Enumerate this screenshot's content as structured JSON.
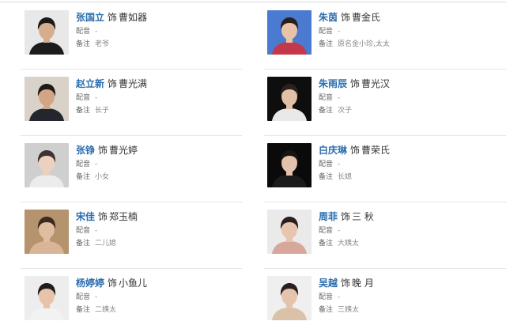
{
  "as_word": "饰",
  "labels": {
    "dub": "配音",
    "note": "备注"
  },
  "cast": [
    {
      "actor": "张国立",
      "role": "曹如器",
      "dub": "-",
      "note": "老爷",
      "photo": {
        "bg": "#e8e8e8",
        "skin": "#d6ad8d",
        "hair": "#1a1a1a",
        "cloth": "#1c1c1c"
      }
    },
    {
      "actor": "朱茵",
      "role": "曹金氏",
      "dub": "-",
      "note": "原名金小珍,太太",
      "photo": {
        "bg": "#4a7bd0",
        "skin": "#e8c3a8",
        "hair": "#2a1e1a",
        "cloth": "#c4384b"
      }
    },
    {
      "actor": "赵立新",
      "role": "曹光满",
      "dub": "-",
      "note": "长子",
      "photo": {
        "bg": "#d9d2c8",
        "skin": "#d2a585",
        "hair": "#1f1b19",
        "cloth": "#23262d"
      }
    },
    {
      "actor": "朱雨辰",
      "role": "曹光汉",
      "dub": "-",
      "note": "次子",
      "photo": {
        "bg": "#0e0e0e",
        "skin": "#e1c0a5",
        "hair": "#2c211d",
        "cloth": "#e9e9e9"
      }
    },
    {
      "actor": "张铮",
      "role": "曹光婷",
      "dub": "-",
      "note": "小女",
      "photo": {
        "bg": "#cfcfcf",
        "skin": "#ecd1bf",
        "hair": "#403230",
        "cloth": "#ececec"
      }
    },
    {
      "actor": "白庆琳",
      "role": "曹荣氏",
      "dub": "-",
      "note": "长媳",
      "photo": {
        "bg": "#0a0a0a",
        "skin": "#e4c1ab",
        "hair": "#1a1414",
        "cloth": "#1b1b1b"
      }
    },
    {
      "actor": "宋佳",
      "role": "郑玉楠",
      "dub": "-",
      "note": "二儿媳",
      "photo": {
        "bg": "#b5936c",
        "skin": "#e1bd9f",
        "hair": "#3b2a20",
        "cloth": "#d8b596"
      }
    },
    {
      "actor": "周菲",
      "role": "三 秋",
      "dub": "-",
      "note": "大姨太",
      "photo": {
        "bg": "#eaeaea",
        "skin": "#e7c5ae",
        "hair": "#2a1f1c",
        "cloth": "#d8a79c"
      }
    },
    {
      "actor": "杨婷婷",
      "role": "小鱼儿",
      "dub": "-",
      "note": "二姨太",
      "photo": {
        "bg": "#ededed",
        "skin": "#e6c3aa",
        "hair": "#241a17",
        "cloth": "#f2f2f2"
      }
    },
    {
      "actor": "吴越",
      "role": "晚 月",
      "dub": "-",
      "note": "三姨太",
      "photo": {
        "bg": "#efefef",
        "skin": "#e5c4ae",
        "hair": "#2a1f1c",
        "cloth": "#d9c2a8"
      }
    }
  ]
}
